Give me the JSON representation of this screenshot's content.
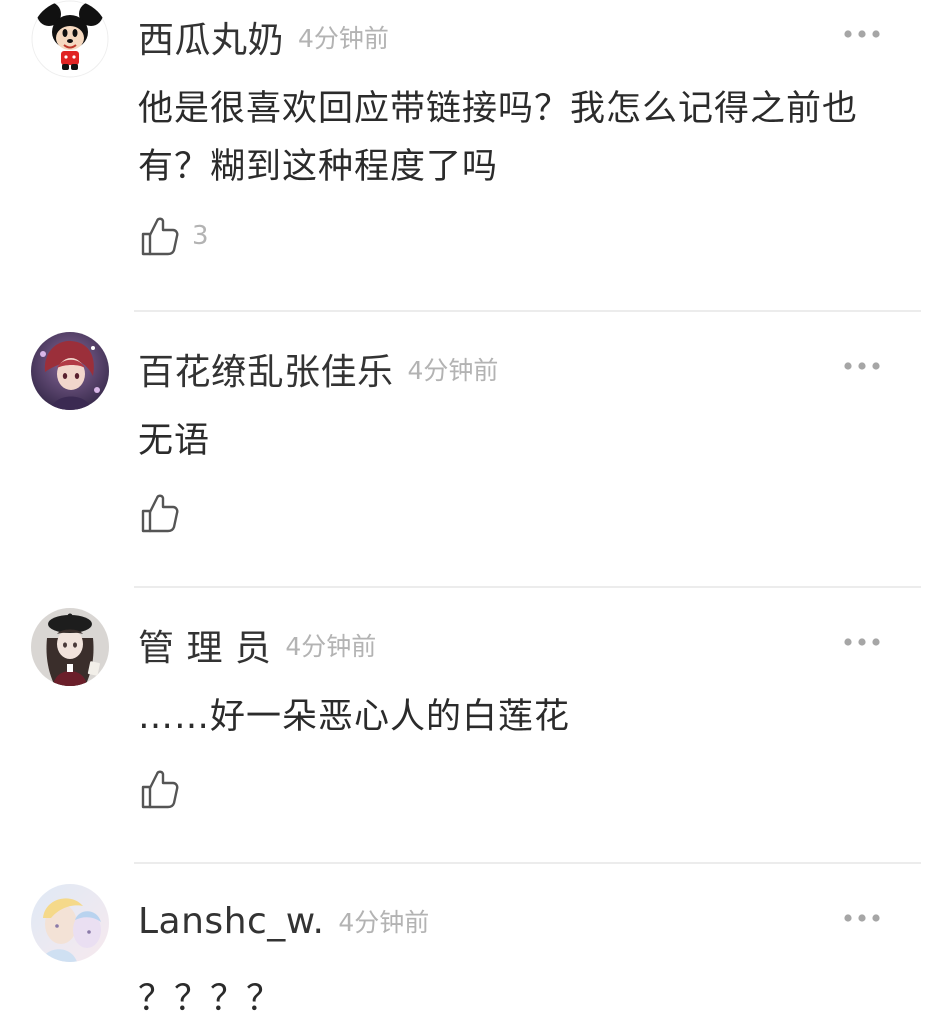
{
  "comments": [
    {
      "username": "西瓜丸奶",
      "time": "4分钟前",
      "text": "他是很喜欢回应带链接吗？我怎么记得之前也有？糊到这种程度了吗",
      "likes": "3",
      "avatar_icon": "cartoon-mouse-avatar"
    },
    {
      "username": "百花缭乱张佳乐",
      "time": "4分钟前",
      "text": "无语",
      "likes": "",
      "avatar_icon": "anime-character-avatar"
    },
    {
      "username": "管 理 员",
      "time": "4分钟前",
      "text": "……好一朵恶心人的白莲花",
      "likes": "",
      "avatar_icon": "anime-girl-beret-avatar"
    },
    {
      "username": "Lanshc_w.",
      "time": "4分钟前",
      "text": "？？？？",
      "likes": "",
      "avatar_icon": "pastel-illustration-avatar"
    }
  ],
  "icons": {
    "more": "more-dots-icon",
    "like": "thumbs-up-icon"
  },
  "colors": {
    "username": "#333333",
    "timestamp": "#b3b3b3",
    "body_text": "#2b2b2b",
    "divider": "#ececec"
  }
}
